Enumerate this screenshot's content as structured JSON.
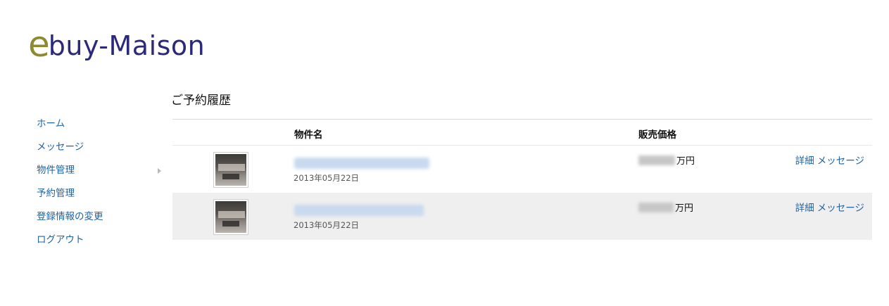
{
  "logo": {
    "e": "e",
    "rest": "buy-Maison"
  },
  "sidebar": {
    "items": [
      {
        "label": "ホーム"
      },
      {
        "label": "メッセージ"
      },
      {
        "label": "物件管理"
      },
      {
        "label": "予約管理"
      },
      {
        "label": "登録情報の変更"
      },
      {
        "label": "ログアウト"
      }
    ]
  },
  "page": {
    "title": "ご予約履歴"
  },
  "table": {
    "headers": {
      "thumb": "",
      "name": "物件名",
      "price": "販売価格",
      "actions": ""
    },
    "rows": [
      {
        "date": "2013年05月22日",
        "price_suffix": "万円",
        "detail": "詳細",
        "message": "メッセージ"
      },
      {
        "date": "2013年05月22日",
        "price_suffix": "万円",
        "detail": "詳細",
        "message": "メッセージ"
      }
    ]
  },
  "colors": {
    "logo_e": "#8d8a2f",
    "logo_text": "#2b2a7a",
    "link": "#1f63a1",
    "row_alt_bg": "#efefef"
  }
}
